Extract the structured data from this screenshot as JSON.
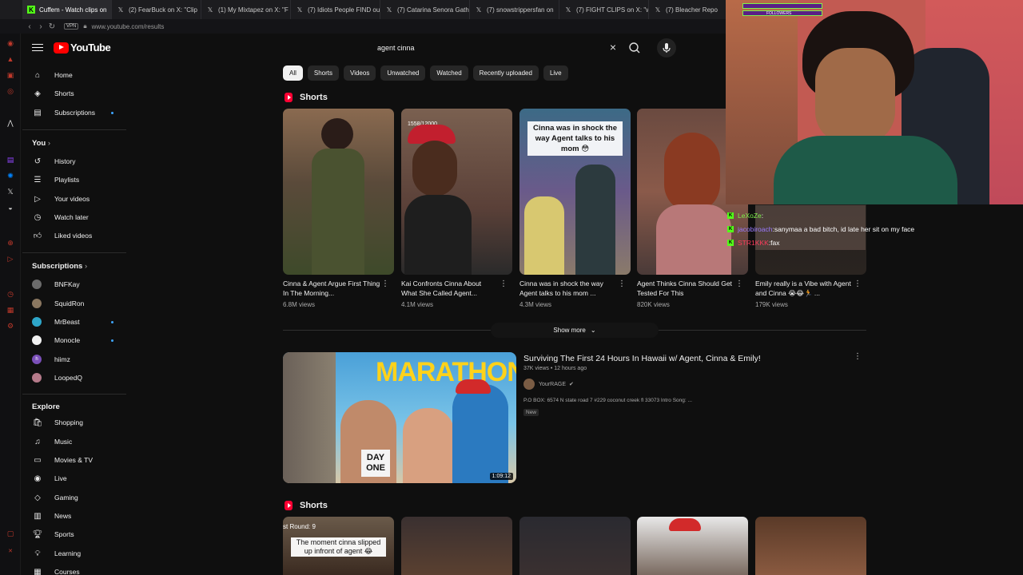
{
  "browser": {
    "tabs": [
      {
        "label": "Cuffem - Watch clips on",
        "icon": "kick-icon",
        "color": "#53fc18",
        "active": true
      },
      {
        "label": "(2) FearBuck on X: \"Clip",
        "icon": "x-icon"
      },
      {
        "label": "(1) My Mixtapez on X: \"F",
        "icon": "x-icon"
      },
      {
        "label": "(7) Idiots People FIND ou",
        "icon": "x-icon"
      },
      {
        "label": "(7) Catarina Senora Gath",
        "icon": "x-icon"
      },
      {
        "label": "(7) snowstrippersfan on",
        "icon": "x-icon"
      },
      {
        "label": "(7) FIGHT CLIPS on X: \"w",
        "icon": "x-icon"
      },
      {
        "label": "(7) Bleacher Repo",
        "icon": "x-icon"
      }
    ],
    "vpn_label": "VPN",
    "url": "www.youtube.com/results"
  },
  "youtube": {
    "logo_text": "YouTube",
    "search": {
      "query": "agent cinna"
    },
    "sidebar": {
      "main": [
        {
          "label": "Home",
          "icon": "home-icon"
        },
        {
          "label": "Shorts",
          "icon": "shorts-icon"
        },
        {
          "label": "Subscriptions",
          "icon": "subscriptions-icon"
        }
      ],
      "you_heading": "You",
      "you_items": [
        {
          "label": "History",
          "icon": "history-icon"
        },
        {
          "label": "Playlists",
          "icon": "playlists-icon"
        },
        {
          "label": "Your videos",
          "icon": "your-videos-icon"
        },
        {
          "label": "Watch later",
          "icon": "watch-later-icon"
        },
        {
          "label": "Liked videos",
          "icon": "liked-icon"
        }
      ],
      "subscriptions_heading": "Subscriptions",
      "subscriptions": [
        {
          "label": "BNFKay",
          "color": "#6b6b6b"
        },
        {
          "label": "SquidRon",
          "color": "#8a7760"
        },
        {
          "label": "MrBeast",
          "color": "#2ea6c9"
        },
        {
          "label": "Monocle",
          "color": "#f1f1f1"
        },
        {
          "label": "hiimz",
          "color": "#7a4fb8"
        },
        {
          "label": "LoopedQ",
          "color": "#b57a8a"
        }
      ],
      "explore_heading": "Explore",
      "explore": [
        {
          "label": "Shopping",
          "icon": "shopping-icon"
        },
        {
          "label": "Music",
          "icon": "music-icon"
        },
        {
          "label": "Movies & TV",
          "icon": "movies-icon"
        },
        {
          "label": "Live",
          "icon": "live-icon"
        },
        {
          "label": "Gaming",
          "icon": "gaming-icon"
        },
        {
          "label": "News",
          "icon": "news-icon"
        },
        {
          "label": "Sports",
          "icon": "sports-icon"
        },
        {
          "label": "Learning",
          "icon": "learning-icon"
        },
        {
          "label": "Courses",
          "icon": "courses-icon"
        }
      ]
    },
    "chips": [
      "All",
      "Shorts",
      "Videos",
      "Unwatched",
      "Watched",
      "Recently uploaded",
      "Live"
    ],
    "shorts_heading": "Shorts",
    "shorts": [
      {
        "title": "Cinna & Agent Argue First Thing In The Morning...",
        "views": "6.8M views",
        "color": "#5a4a3a"
      },
      {
        "title": "Kai Confronts Cinna About What She Called Agent...",
        "views": "4.1M views",
        "color": "#6a5040",
        "overlay": "1558/12000"
      },
      {
        "title": "Cinna was in shock the way Agent talks to his mom ...",
        "views": "4.3M views",
        "color": "#4a6a7a",
        "overlay": "Cinna was in shock the way Agent talks to his mom 😳"
      },
      {
        "title": "Agent Thinks Cinna Should Get Tested For This",
        "views": "820K views",
        "color": "#7a4a3a"
      },
      {
        "title": "Emily really is a Vibe with Agent and Cinna 😭😂🏃 ...",
        "views": "179K views",
        "color": "#5a4438"
      }
    ],
    "show_more": "Show more",
    "video": {
      "title": "Surviving The First 24 Hours In Hawaii w/ Agent, Cinna & Emily!",
      "meta": "37K views • 12 hours ago",
      "channel": "YourRAGE",
      "description": "P.O BOX: 6574 N state road 7 #229 coconut creek fl 33073 Intro Song: ...",
      "badge": "New",
      "duration": "1:09:12",
      "thumb_text": "MARATHON",
      "thumb_sign": "DAY ONE"
    },
    "shorts2_heading": "Shorts",
    "shorts2": [
      {
        "caption": "The moment cinna slipped up infront of agent 😂",
        "label": "st Round: 9",
        "color": "#3a2a20"
      },
      {
        "color": "#4a3a30"
      },
      {
        "color": "#2a2a30"
      },
      {
        "color": "#8a8a8a"
      },
      {
        "color": "#6a4a38"
      }
    ]
  },
  "stream_overlay": {
    "chat": [
      {
        "user": "LeXoZe",
        "message": "",
        "user_color": "#7ef24a"
      },
      {
        "user": "jacobiroach",
        "message": "sanymaa a bad bitch, id late her sit on my face",
        "user_color": "#9b7bff"
      },
      {
        "user": "STR1KKK",
        "message": "fax",
        "user_color": "#ff3b5c"
      }
    ],
    "goal_label": "FOLLOWERS"
  }
}
